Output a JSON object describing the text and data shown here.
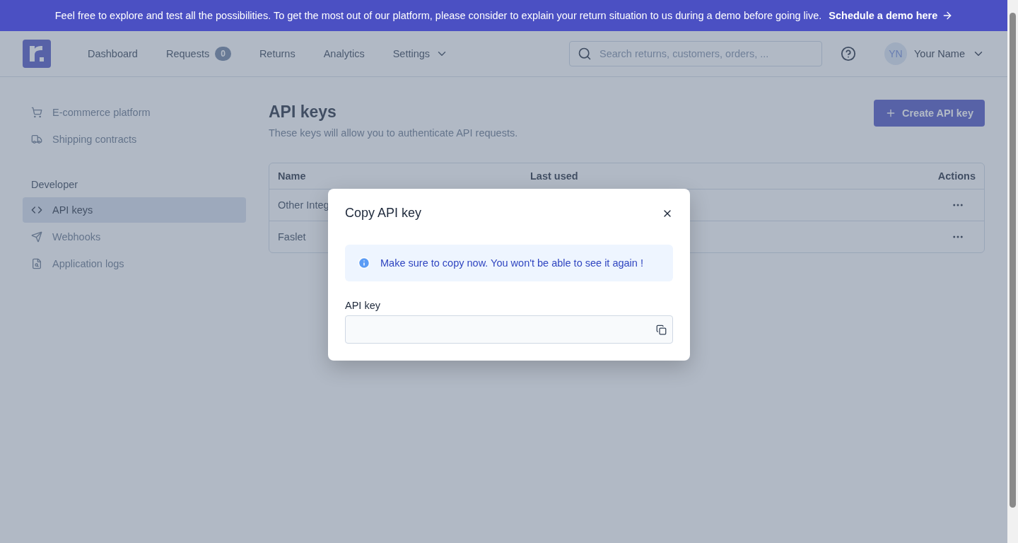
{
  "banner": {
    "text": "Feel free to explore and test all the possibilities. To get the most out of our platform, please consider to explain your return situation to us during a demo before going live.",
    "link": "Schedule a demo here"
  },
  "nav": {
    "items": [
      {
        "label": "Dashboard",
        "kind": "link"
      },
      {
        "label": "Requests",
        "kind": "count",
        "badge": "0"
      },
      {
        "label": "Returns",
        "kind": "link"
      },
      {
        "label": "Analytics",
        "kind": "link"
      },
      {
        "label": "Settings",
        "kind": "menu"
      }
    ],
    "search": {
      "placeholder": "Search returns, customers, orders, ..."
    },
    "user": {
      "initials": "YN",
      "name": "Your Name"
    }
  },
  "sidebar": {
    "groups": [
      {
        "items": [
          {
            "label": "E-commerce platform",
            "kind": "cart",
            "selected": false
          },
          {
            "label": "Shipping contracts",
            "kind": "truck",
            "selected": false
          }
        ]
      },
      {
        "title": "Developer",
        "items": [
          {
            "label": "API keys",
            "kind": "code",
            "selected": true
          },
          {
            "label": "Webhooks",
            "kind": "send",
            "selected": false
          },
          {
            "label": "Application logs",
            "kind": "log",
            "selected": false
          }
        ]
      }
    ]
  },
  "page": {
    "title": "API keys",
    "subtitle": "These keys will allow you to authenticate API requests.",
    "create_button": "Create API key"
  },
  "table": {
    "columns": [
      "Name",
      "Last used",
      "Actions"
    ],
    "rows": [
      {
        "name": "Other Integ"
      },
      {
        "name": "Faslet"
      }
    ]
  },
  "modal": {
    "title": "Copy API key",
    "alert": "Make sure to copy now. You won't be able to see it again !",
    "field_label": "API key"
  }
}
